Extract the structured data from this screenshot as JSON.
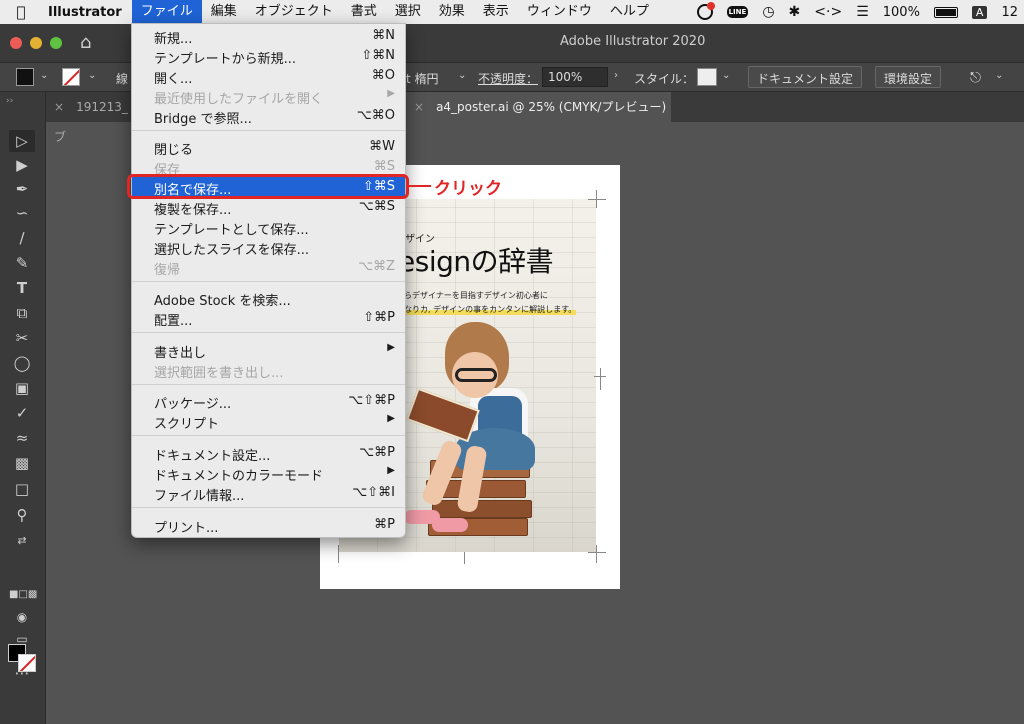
{
  "menubar": {
    "apple": "",
    "app_name": "Illustrator",
    "menus": [
      "ファイル",
      "編集",
      "オブジェクト",
      "書式",
      "選択",
      "効果",
      "表示",
      "ウィンドウ",
      "ヘルプ"
    ],
    "battery": "100%",
    "input_badge": "A",
    "clock": "12"
  },
  "window": {
    "title": "Adobe Illustrator 2020"
  },
  "controlbar": {
    "stroke_label": "線",
    "brush_label": "t 楕円",
    "opacity_label": "不透明度：",
    "opacity_value": "100%",
    "style_label": "スタイル：",
    "doc_settings_button": "ドキュメント設定",
    "prefs_button": "環境設定"
  },
  "tabs": [
    {
      "label": "191213_ブ",
      "active": false
    },
    {
      "label": "a4_poster.ai @ 25% (CMYK/プレビュー)",
      "active": true
    }
  ],
  "file_menu": {
    "items": [
      {
        "label": "新規...",
        "shortcut": "⌘N",
        "disabled": false
      },
      {
        "label": "テンプレートから新規...",
        "shortcut": "⇧⌘N",
        "disabled": false
      },
      {
        "label": "開く...",
        "shortcut": "⌘O",
        "disabled": false
      },
      {
        "label": "最近使用したファイルを開く",
        "shortcut": "▶",
        "disabled": true
      },
      {
        "label": "Bridge で参照...",
        "shortcut": "⌥⌘O",
        "disabled": false
      },
      {
        "label": "閉じる",
        "shortcut": "⌘W",
        "disabled": false
      },
      {
        "label": "保存",
        "shortcut": "⌘S",
        "disabled": true
      },
      {
        "label": "別名で保存...",
        "shortcut": "⇧⌘S",
        "disabled": false,
        "highlighted": true
      },
      {
        "label": "複製を保存...",
        "shortcut": "⌥⌘S",
        "disabled": false
      },
      {
        "label": "テンプレートとして保存...",
        "shortcut": "",
        "disabled": false
      },
      {
        "label": "選択したスライスを保存...",
        "shortcut": "",
        "disabled": false
      },
      {
        "label": "復帰",
        "shortcut": "⌥⌘Z",
        "disabled": true
      },
      {
        "label": "Adobe Stock を検索...",
        "shortcut": "",
        "disabled": false
      },
      {
        "label": "配置...",
        "shortcut": "⇧⌘P",
        "disabled": false
      },
      {
        "label": "書き出し",
        "shortcut": "▶",
        "disabled": false
      },
      {
        "label": "選択範囲を書き出し...",
        "shortcut": "",
        "disabled": true
      },
      {
        "label": "パッケージ...",
        "shortcut": "⌥⇧⌘P",
        "disabled": false
      },
      {
        "label": "スクリプト",
        "shortcut": "▶",
        "disabled": false
      },
      {
        "label": "ドキュメント設定...",
        "shortcut": "⌥⌘P",
        "disabled": false
      },
      {
        "label": "ドキュメントのカラーモード",
        "shortcut": "▶",
        "disabled": false
      },
      {
        "label": "ファイル情報...",
        "shortcut": "⌥⇧⌘I",
        "disabled": false
      },
      {
        "label": "プリント...",
        "shortcut": "⌘P",
        "disabled": false
      }
    ]
  },
  "poster": {
    "subtitle": "デザイン",
    "title": "esignの辞書",
    "line1": "からデザイナーを目指すデザイン初心者に",
    "line2": "のなりカ, デザインの事をカンタンに解説します。"
  },
  "annotation": {
    "text": "クリック"
  },
  "colors": {
    "highlight": "#1f63d6",
    "annotation": "#e12424"
  },
  "tools": [
    "selection-tool",
    "direct-selection-tool",
    "pen-tool",
    "curvature-tool",
    "line-tool",
    "pencil-tool",
    "type-tool",
    "rotate-tool",
    "scissors-tool",
    "shape-builder-tool",
    "gradient-tool",
    "eyedropper-tool",
    "blend-tool",
    "symbol-sprayer-tool",
    "artboard-tool",
    "zoom-tool"
  ]
}
